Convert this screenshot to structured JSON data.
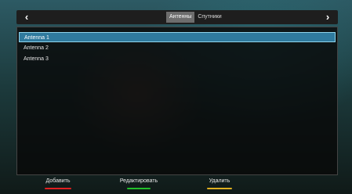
{
  "header": {
    "tabs": [
      {
        "label": "Антенны",
        "active": true
      },
      {
        "label": "Спутники",
        "active": false
      }
    ]
  },
  "list": {
    "items": [
      {
        "label": "Antenna 1",
        "selected": true
      },
      {
        "label": "Antenna 2",
        "selected": false
      },
      {
        "label": "Antenna 3",
        "selected": false
      }
    ]
  },
  "footer": {
    "buttons": [
      {
        "label": "Добавить",
        "color": "#e02020"
      },
      {
        "label": "Редактировать",
        "color": "#22c02a"
      },
      {
        "label": "Удалить",
        "color": "#e0b020"
      }
    ]
  },
  "icons": {
    "left": "chevron-left-icon",
    "right": "chevron-right-icon"
  }
}
